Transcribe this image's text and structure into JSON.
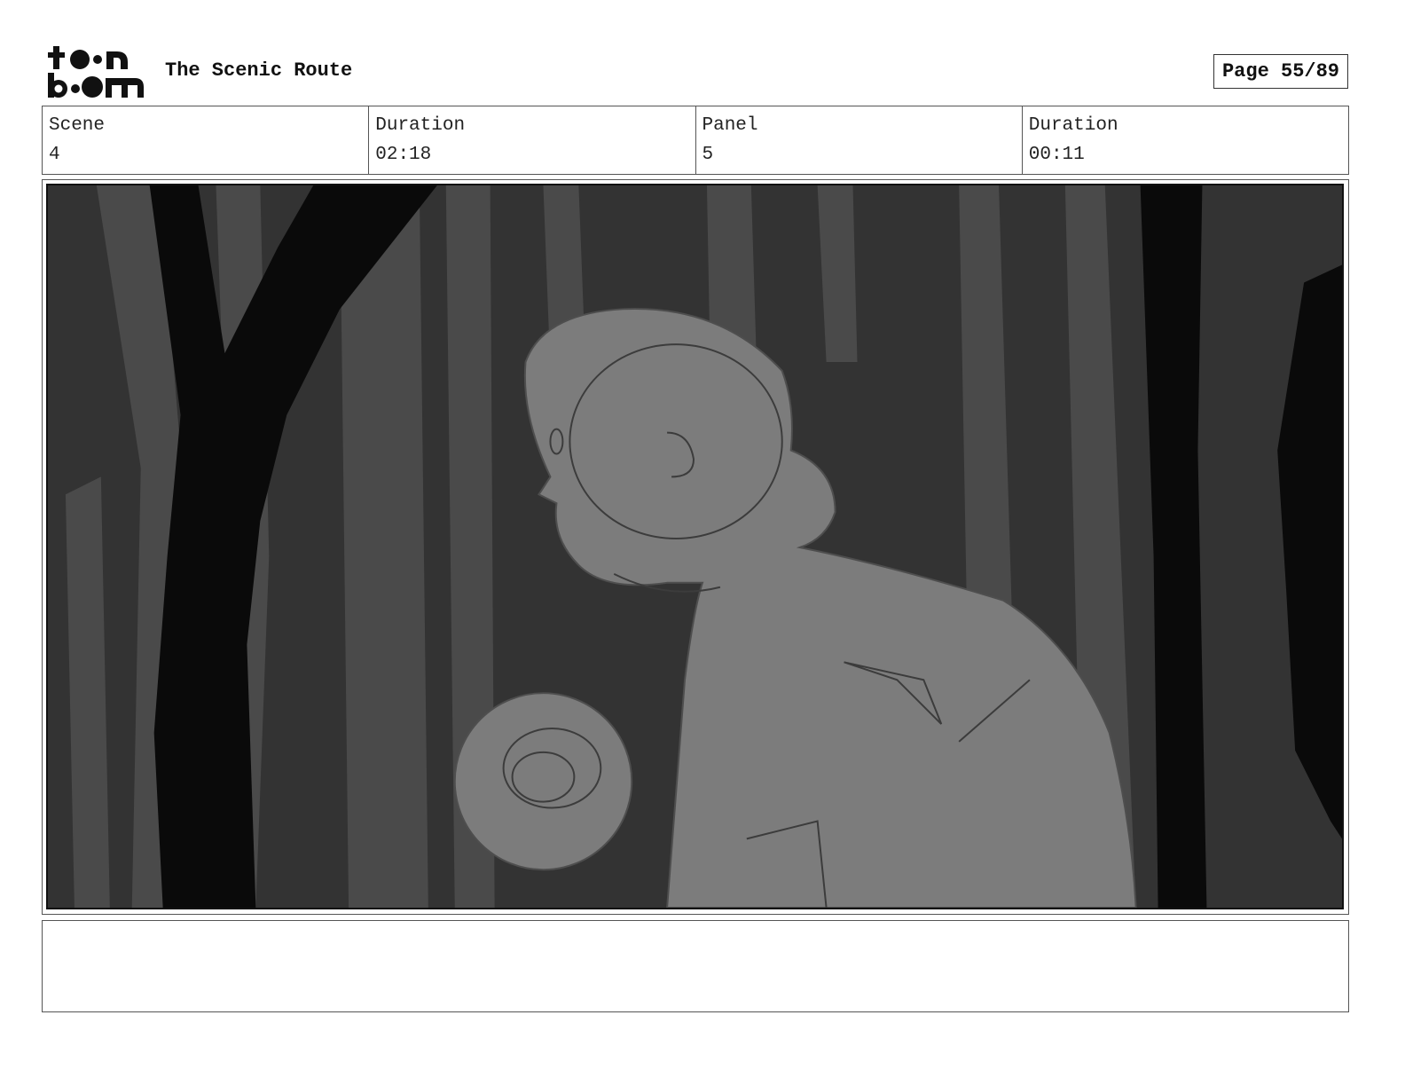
{
  "header": {
    "logo": {
      "text_top": "toon",
      "text_bottom": "boom",
      "icon": "toon-boom-logo"
    },
    "project_title": "The Scenic Route",
    "page_label": "Page 55/89"
  },
  "info": {
    "scene_label": "Scene",
    "scene_value": "4",
    "scene_duration_label": "Duration",
    "scene_duration_value": "02:18",
    "panel_label": "Panel",
    "panel_value": "5",
    "panel_duration_label": "Duration",
    "panel_duration_value": "00:11"
  },
  "panel": {
    "image": "storyboard-sketch-forest-character",
    "colors": {
      "background": "#333333",
      "trees_light": "#4a4a4a",
      "trees_dark": "#0a0a0a",
      "character": "#7c7c7c"
    }
  },
  "notes": {
    "text": ""
  }
}
